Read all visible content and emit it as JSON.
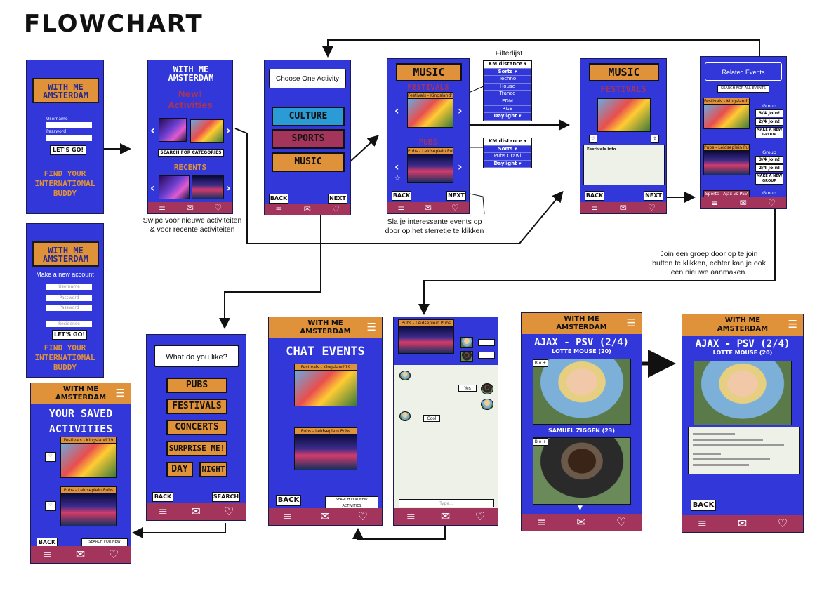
{
  "title": "FLOWCHART",
  "colors": {
    "phone_blue": "#3137d9",
    "accent_orange": "#e0923a",
    "tab_maroon": "#a3355d"
  },
  "logo_text": "WITH ME\nAMSTERDAM",
  "tab_icons": {
    "list": "≡",
    "mail": "✉",
    "heart": "♡"
  },
  "annotations": {
    "swipe": "Swipe voor nieuwe activiteiten\n& voor recente activiteiten",
    "star": "Sla je interessante events op\ndoor op het sterretje te klikken",
    "filter_title": "Filterlijst",
    "join": "Join een groep door op te join\nbutton te klikken, echter kan je ook\neen nieuwe aanmaken."
  },
  "login": {
    "username_label": "Username",
    "password_label": "Password",
    "button": "LET'S GO!",
    "tagline": "FIND YOUR\nINTERNATIONAL\nBUDDY"
  },
  "register": {
    "heading": "Make a new account",
    "fields": [
      "Username",
      "Password",
      "Password",
      "Residence"
    ],
    "button": "LET'S GO!",
    "tagline": "FIND YOUR\nINTERNATIONAL\nBUDDY"
  },
  "home": {
    "new_title": "New!\nActivities",
    "search_button": "SEARCH FOR CATEGORIES",
    "recents": "RECENTS"
  },
  "choose": {
    "heading": "Choose One Activity",
    "options": [
      "CULTURE",
      "SPORTS",
      "MUSIC"
    ],
    "back": "BACK",
    "next": "NEXT"
  },
  "music_list": {
    "heading": "MUSIC",
    "section1": "FESTIVALS",
    "section2": "PUBS",
    "event1": "Festivals - Kingsland'19",
    "event2": "Pubs - Leidseplein Pubs",
    "back": "BACK",
    "next": "NEXT"
  },
  "filters1": [
    "KM distance ▾",
    "Sorts ▾",
    "Techno",
    "House",
    "Trance",
    "EDM",
    "R&B",
    "Daylight ▾"
  ],
  "filters2": [
    "KM distance ▾",
    "Sorts ▾",
    "Pubs Crawl",
    "Daylight ▾"
  ],
  "music_detail": {
    "heading": "MUSIC",
    "section": "FESTIVALS",
    "info": "Festivals info",
    "back": "BACK",
    "next": "NEXT"
  },
  "related": {
    "heading": "Related Events",
    "search": "SEARCH FOR ALL EVENTS",
    "event1": "Festivals - Kingsland'19",
    "event2": "Pubs - Leidseplein Pubs",
    "event3": "Sports - Ajax vs PSV",
    "group_label": "Group",
    "groups": [
      "3/4",
      "2/4",
      "3/4",
      "2/4"
    ],
    "join": "Join!",
    "make_group": "MAKE A NEW GROUP"
  },
  "preferences": {
    "heading": "What do you like?",
    "options": [
      "PUBS",
      "FESTIVALS",
      "CONCERTS",
      "SURPRISE ME!"
    ],
    "day": "DAY",
    "night": "NIGHT",
    "back": "BACK",
    "search": "SEARCH"
  },
  "saved": {
    "heading": "YOUR SAVED\nACTIVITIES",
    "event1": "Festivals - Kingsland'19",
    "event2": "Pubs - Leidseplein Pubs",
    "back": "BACK",
    "search": "SEARCH FOR NEW ACTIVITIES"
  },
  "chat_events": {
    "heading": "CHAT EVENTS",
    "event1": "Festivals - Kingsland'19",
    "event2": "Pubs - Leidseplein Pubs",
    "back": "BACK",
    "search": "SEARCH FOR NEW ACTIVITIES"
  },
  "chat": {
    "event": "Pubs - Leidseplein Pubs",
    "messages": [
      "Cool",
      "Yes",
      "Bye!"
    ],
    "input_placeholder": "Type..."
  },
  "match": {
    "heading": "AJAX - PSV (2/4)",
    "person1": "LOTTE MOUSE (20)",
    "person2": "SAMUEL ZIGGEN (23)",
    "bio": "Bio +",
    "back": "BACK"
  }
}
